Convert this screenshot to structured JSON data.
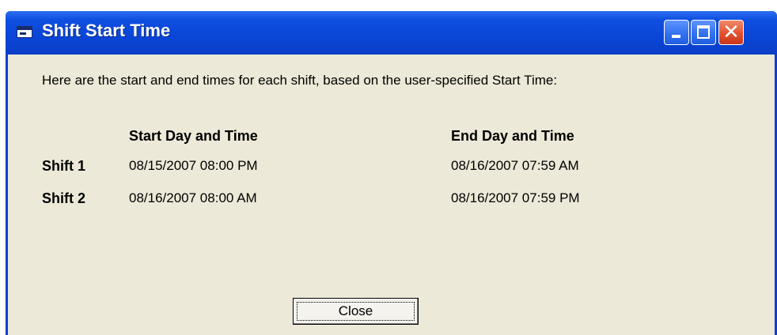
{
  "window": {
    "title": "Shift Start Time",
    "icon": "window-icon",
    "controls": {
      "minimize_icon": "minimize-icon",
      "maximize_icon": "maximize-icon",
      "close_icon": "close-icon",
      "close_glyph": "✕"
    },
    "title_bar_color": "#0a45d6",
    "close_button_color": "#e3512f",
    "client_background": "#ece9d8"
  },
  "content": {
    "intro": "Here are the start and end times for each shift, based on the user-specified Start Time:",
    "columns": {
      "start": "Start Day and Time",
      "end": "End Day and Time"
    },
    "shifts": [
      {
        "label": "Shift 1",
        "start": "08/15/2007 08:00 PM",
        "end": "08/16/2007 07:59 AM"
      },
      {
        "label": "Shift 2",
        "start": "08/16/2007 08:00 AM",
        "end": "08/16/2007 07:59 PM"
      }
    ]
  },
  "buttons": {
    "close_label": "Close"
  }
}
